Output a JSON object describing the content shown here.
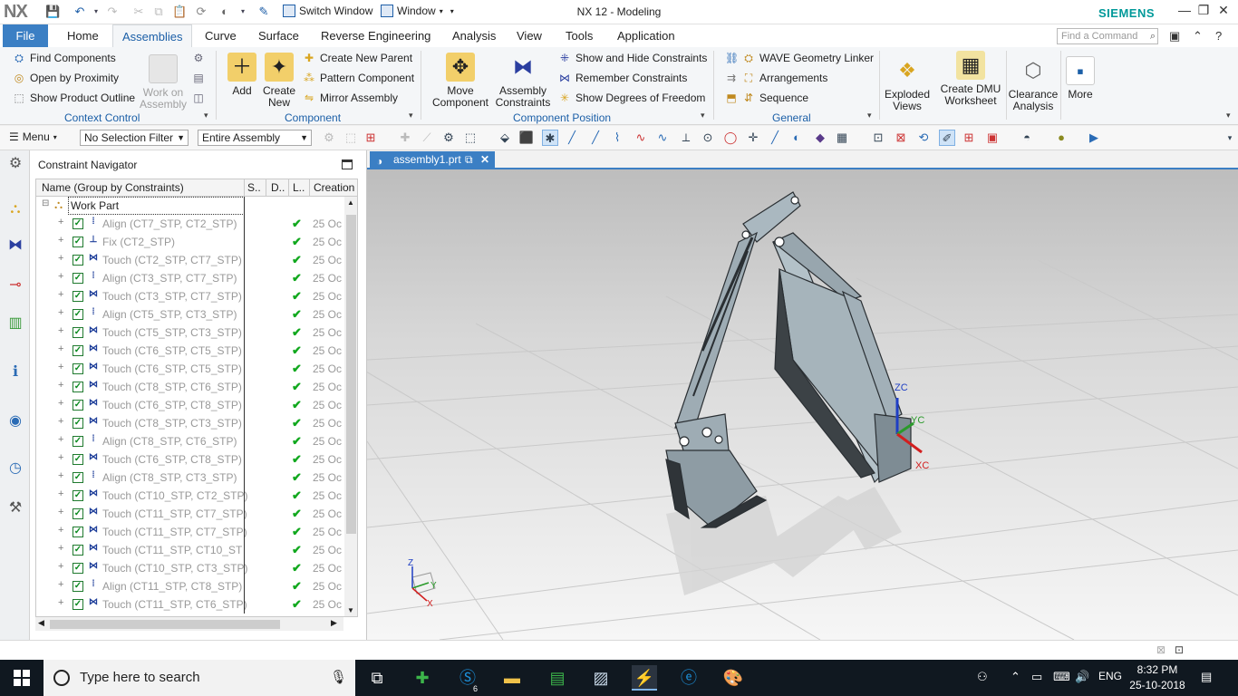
{
  "titlebar": {
    "logo": "NX",
    "switch_window": "Switch Window",
    "window_menu": "Window",
    "title": "NX 12 - Modeling",
    "brand": "SIEMENS"
  },
  "tabs": {
    "file": "File",
    "items": [
      "Home",
      "Assemblies",
      "Curve",
      "Surface",
      "Reverse Engineering",
      "Analysis",
      "View",
      "Tools",
      "Application"
    ],
    "active": "Assemblies",
    "find_placeholder": "Find a Command"
  },
  "ribbon": {
    "context": {
      "find_components": "Find Components",
      "open_by_proximity": "Open by Proximity",
      "show_product_outline": "Show Product Outline",
      "work_on_assembly": "Work on Assembly",
      "label": "Context Control"
    },
    "component": {
      "add": "Add",
      "create_new": "Create New",
      "create_new_parent": "Create New Parent",
      "pattern_component": "Pattern Component",
      "mirror_assembly": "Mirror Assembly",
      "label": "Component"
    },
    "position": {
      "move_component": "Move Component",
      "assembly_constraints": "Assembly Constraints",
      "show_hide_constraints": "Show and Hide Constraints",
      "remember_constraints": "Remember Constraints",
      "show_dof": "Show Degrees of Freedom",
      "label": "Component Position"
    },
    "general": {
      "wave_linker": "WAVE Geometry Linker",
      "arrangements": "Arrangements",
      "sequence": "Sequence",
      "label": "General"
    },
    "extra": {
      "exploded_views": "Exploded Views",
      "create_dmu": "Create DMU Worksheet",
      "clearance": "Clearance Analysis",
      "more": "More"
    }
  },
  "toolbar": {
    "menu": "Menu",
    "selection_filter": "No Selection Filter",
    "scope": "Entire Assembly"
  },
  "navigator": {
    "title": "Constraint Navigator",
    "columns": [
      "Name (Group by Constraints)",
      "S..",
      "D..",
      "L..",
      "Creation"
    ],
    "work_part": "Work Part",
    "rows": [
      {
        "type": "Align",
        "name": "Align (CT7_STP, CT2_STP)",
        "date": "25 Oc"
      },
      {
        "type": "Fix",
        "name": "Fix (CT2_STP)",
        "date": "25 Oc"
      },
      {
        "type": "Touch",
        "name": "Touch (CT2_STP, CT7_STP)",
        "date": "25 Oc"
      },
      {
        "type": "Align",
        "name": "Align (CT3_STP, CT7_STP)",
        "date": "25 Oc"
      },
      {
        "type": "Touch",
        "name": "Touch (CT3_STP, CT7_STP)",
        "date": "25 Oc"
      },
      {
        "type": "Align",
        "name": "Align (CT5_STP, CT3_STP)",
        "date": "25 Oc"
      },
      {
        "type": "Touch",
        "name": "Touch (CT5_STP, CT3_STP)",
        "date": "25 Oc"
      },
      {
        "type": "Touch",
        "name": "Touch (CT6_STP, CT5_STP)",
        "date": "25 Oc"
      },
      {
        "type": "Touch",
        "name": "Touch (CT6_STP, CT5_STP)",
        "date": "25 Oc"
      },
      {
        "type": "Touch",
        "name": "Touch (CT8_STP, CT6_STP)",
        "date": "25 Oc"
      },
      {
        "type": "Touch",
        "name": "Touch (CT6_STP, CT8_STP)",
        "date": "25 Oc"
      },
      {
        "type": "Touch",
        "name": "Touch (CT8_STP, CT3_STP)",
        "date": "25 Oc"
      },
      {
        "type": "Align",
        "name": "Align (CT8_STP, CT6_STP)",
        "date": "25 Oc"
      },
      {
        "type": "Touch",
        "name": "Touch (CT6_STP, CT8_STP)",
        "date": "25 Oc"
      },
      {
        "type": "Align",
        "name": "Align (CT8_STP, CT3_STP)",
        "date": "25 Oc"
      },
      {
        "type": "Touch",
        "name": "Touch (CT10_STP, CT2_STP)",
        "date": "25 Oc"
      },
      {
        "type": "Touch",
        "name": "Touch (CT11_STP, CT7_STP)",
        "date": "25 Oc"
      },
      {
        "type": "Touch",
        "name": "Touch (CT11_STP, CT7_STP)",
        "date": "25 Oc"
      },
      {
        "type": "Touch",
        "name": "Touch (CT11_STP, CT10_ST",
        "date": "25 Oc"
      },
      {
        "type": "Touch",
        "name": "Touch (CT10_STP, CT3_STP)",
        "date": "25 Oc"
      },
      {
        "type": "Align",
        "name": "Align (CT11_STP, CT8_STP)",
        "date": "25 Oc"
      },
      {
        "type": "Touch",
        "name": "Touch (CT11_STP, CT6_STP)",
        "date": "25 Oc"
      }
    ]
  },
  "graphics": {
    "doc_tab": "assembly1.prt",
    "axis_zc": "ZC",
    "axis_yc": "YC",
    "axis_xc": "XC",
    "triad_z": "Z",
    "triad_y": "Y",
    "triad_x": "X"
  },
  "taskbar": {
    "search": "Type here to search",
    "skype_badge": "6",
    "lang": "ENG",
    "time": "8:32 PM",
    "date": "25-10-2018"
  }
}
